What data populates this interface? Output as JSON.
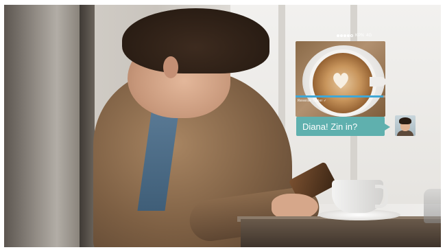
{
  "status_bar": {
    "signal_bars_filled": 4,
    "signal_bars_total": 5,
    "carrier": "KPN",
    "network": "4G"
  },
  "photo_card": {
    "caption": "Reverse Tabler ✓",
    "progress": 0.98,
    "progress_color": "#3fa7d6"
  },
  "message": {
    "text": "Diana! Zin in?",
    "bubble_color": "#5fb0ae"
  },
  "avatar": {
    "icon": "contact-avatar"
  }
}
